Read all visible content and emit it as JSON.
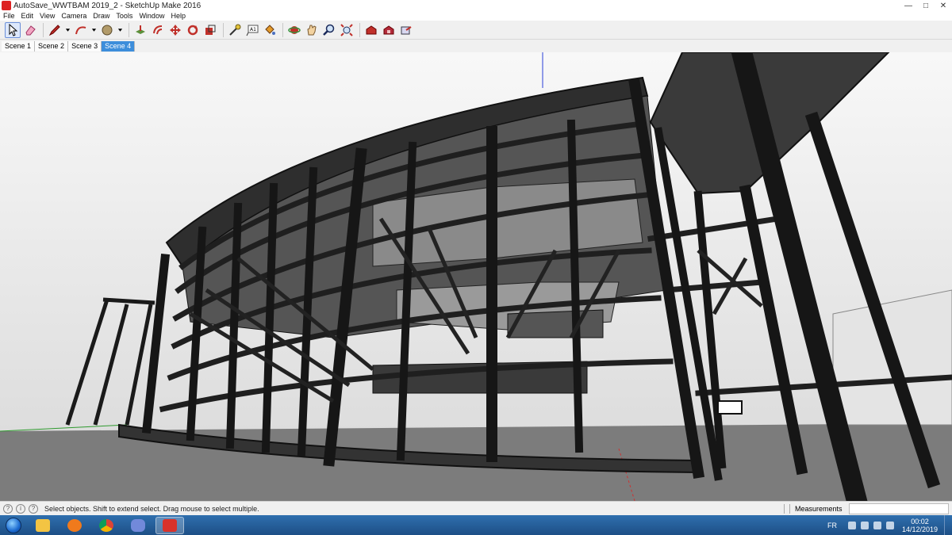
{
  "window": {
    "title": "AutoSave_WWTBAM 2019_2 - SketchUp Make 2016",
    "controls": [
      "minimize-icon",
      "maximize-icon",
      "close-icon"
    ]
  },
  "menu": [
    "File",
    "Edit",
    "View",
    "Camera",
    "Draw",
    "Tools",
    "Window",
    "Help"
  ],
  "toolbar": {
    "tools": [
      {
        "name": "select-tool",
        "icon": "arrow-icon",
        "active": true
      },
      {
        "name": "eraser-tool",
        "icon": "eraser-icon"
      },
      {
        "name": "line-tool",
        "icon": "pencil-icon",
        "dropdown": true
      },
      {
        "name": "arc-tool",
        "icon": "arc-icon",
        "dropdown": true
      },
      {
        "name": "shapes-tool",
        "icon": "circle-icon",
        "dropdown": true
      },
      {
        "name": "push-pull-tool",
        "icon": "push-pull-icon"
      },
      {
        "name": "offset-tool",
        "icon": "offset-icon"
      },
      {
        "name": "move-tool",
        "icon": "move-icon"
      },
      {
        "name": "rotate-tool",
        "icon": "rotate-icon"
      },
      {
        "name": "scale-tool",
        "icon": "scale-icon"
      },
      {
        "name": "tape-measure-tool",
        "icon": "tape-icon"
      },
      {
        "name": "text-tool",
        "icon": "text-icon"
      },
      {
        "name": "paint-bucket-tool",
        "icon": "paint-bucket-icon"
      },
      {
        "name": "orbit-tool",
        "icon": "orbit-icon"
      },
      {
        "name": "pan-tool",
        "icon": "hand-icon"
      },
      {
        "name": "zoom-tool",
        "icon": "magnifier-icon"
      },
      {
        "name": "zoom-extents-tool",
        "icon": "zoom-extents-icon"
      },
      {
        "name": "warehouse-tool",
        "icon": "warehouse-icon"
      },
      {
        "name": "extension-warehouse-tool",
        "icon": "extension-icon"
      },
      {
        "name": "share-model-tool",
        "icon": "share-icon"
      }
    ]
  },
  "scenes": [
    {
      "label": "Scene 1",
      "active": false
    },
    {
      "label": "Scene 2",
      "active": false
    },
    {
      "label": "Scene 3",
      "active": false
    },
    {
      "label": "Scene 4",
      "active": true
    }
  ],
  "status": {
    "hint": "Select objects. Shift to extend select. Drag mouse to select multiple.",
    "measurements_label": "Measurements",
    "measurements_value": ""
  },
  "taskbar": {
    "apps": [
      {
        "name": "file-explorer",
        "color": "#f3c443"
      },
      {
        "name": "media-player",
        "color": "#f07a1c"
      },
      {
        "name": "chrome",
        "color": "#3aa845"
      },
      {
        "name": "discord",
        "color": "#7289da"
      },
      {
        "name": "sketchup",
        "color": "#d8322a",
        "active": true
      }
    ],
    "language": "FR",
    "time": "00:02",
    "date": "14/12/2019"
  },
  "colors": {
    "structure": "#2a2a2a",
    "selection": "#3d8edb",
    "taskbar": "#245e9c"
  }
}
